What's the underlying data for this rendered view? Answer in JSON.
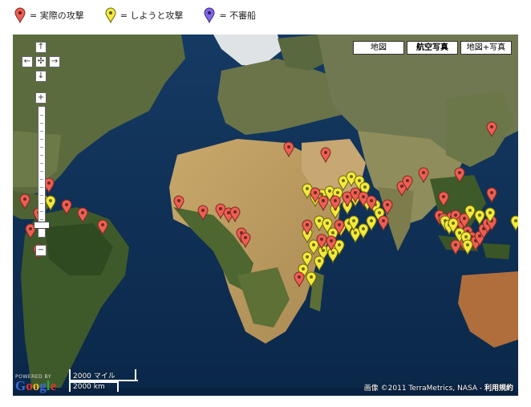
{
  "legend": [
    {
      "color": "#ee5e52",
      "label": "= 実際の攻撃"
    },
    {
      "color": "#f2ea3c",
      "label": "= しようと攻撃"
    },
    {
      "color": "#8266e6",
      "label": "= 不審船"
    }
  ],
  "map_type_buttons": [
    {
      "label": "地図",
      "active": false
    },
    {
      "label": "航空写真",
      "active": true
    },
    {
      "label": "地図+写真",
      "active": false
    }
  ],
  "nav": {
    "up": "↑",
    "left": "←",
    "center": "✣",
    "right": "→",
    "down": "↓",
    "zoom_in": "+",
    "zoom_out": "−"
  },
  "logo": {
    "powered": "POWERED BY",
    "google": "Google"
  },
  "scale": {
    "imperial": "2000 マイル",
    "metric": "2000 km"
  },
  "attribution": {
    "text": "画像 ©2011 TerraMetrics, NASA -",
    "terms": "利用規約"
  },
  "colors": {
    "ocean": "#0d2f55",
    "red_pin": "#ee5e52",
    "yellow_pin": "#f2ea3c",
    "purple_pin": "#8266e6"
  }
}
